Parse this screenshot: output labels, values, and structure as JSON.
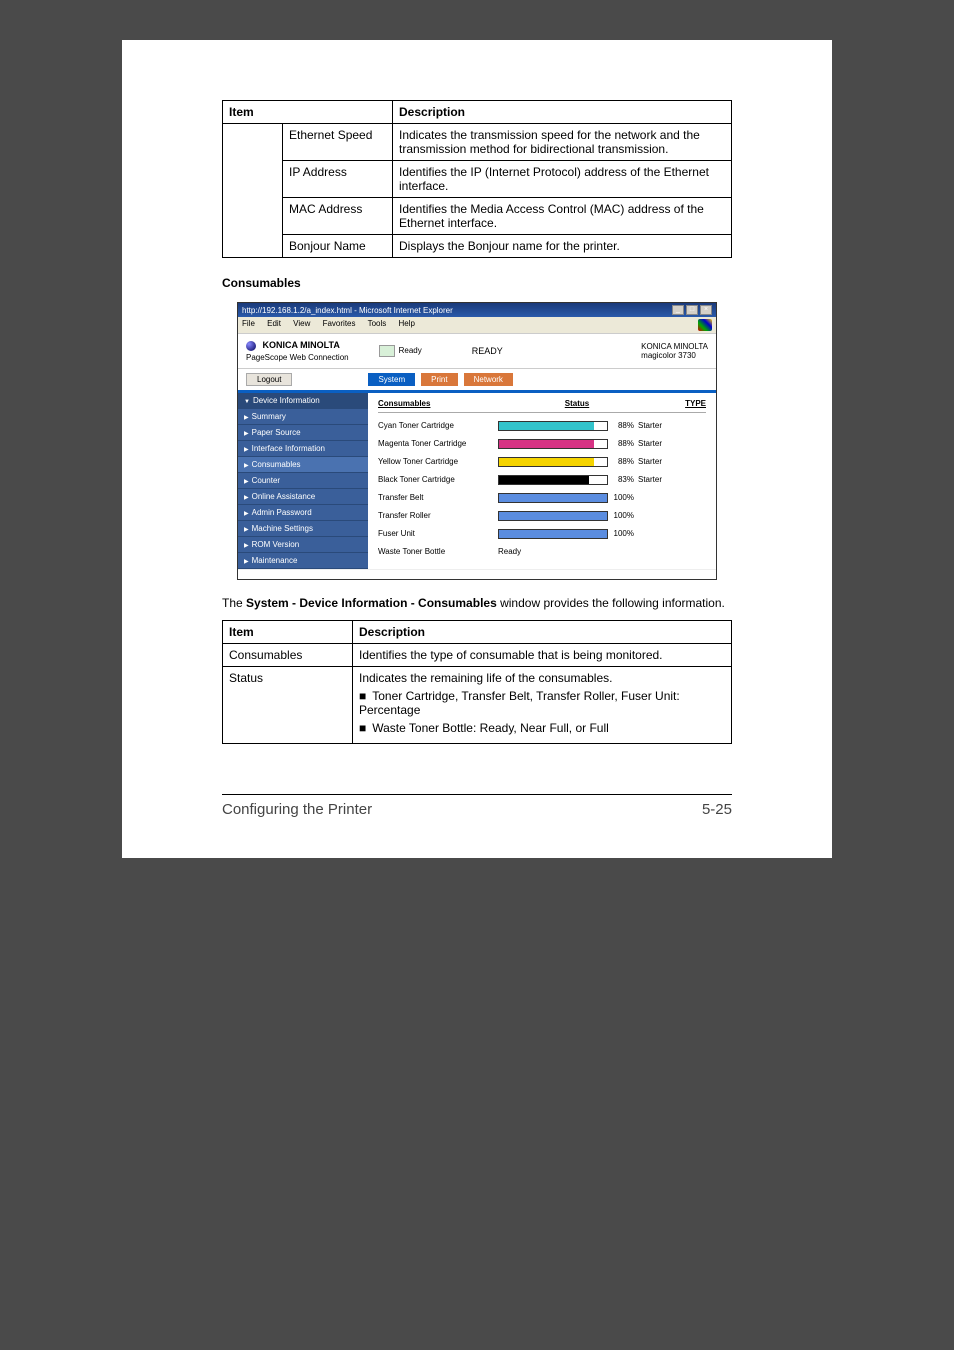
{
  "table1": {
    "headers": {
      "item": "Item",
      "desc": "Description"
    },
    "rows": [
      {
        "item": "Ethernet Speed",
        "desc": "Indicates the transmission speed for the network and the transmission method for bidirectional transmission."
      },
      {
        "item": "IP Address",
        "desc": "Identifies the IP (Internet Protocol) address of the Ethernet interface."
      },
      {
        "item": "MAC Address",
        "desc": "Identifies the Media Access Control (MAC) address of the Ethernet interface."
      },
      {
        "item": "Bonjour Name",
        "desc": "Displays the Bonjour name for the printer."
      }
    ]
  },
  "sectionHeading": "Consumables",
  "screenshot": {
    "titlebar": "http://192.168.1.2/a_index.html - Microsoft Internet Explorer",
    "winControls": {
      "min": "_",
      "max": "□",
      "close": "×"
    },
    "menubar": [
      "File",
      "Edit",
      "View",
      "Favorites",
      "Tools",
      "Help"
    ],
    "brand": "KONICA MINOLTA",
    "webconn": "PageScope Web Connection",
    "statusText": "Ready",
    "centerStatus": "READY",
    "rightBrand1": "KONICA MINOLTA",
    "rightBrand2": "magicolor 3730",
    "logout": "Logout",
    "tabs": {
      "system": "System",
      "print": "Print",
      "network": "Network"
    },
    "sidebar": [
      {
        "label": "Device Information",
        "type": "header"
      },
      {
        "label": "Summary",
        "type": "sub"
      },
      {
        "label": "Paper Source",
        "type": "sub"
      },
      {
        "label": "Interface Information",
        "type": "sub"
      },
      {
        "label": "Consumables",
        "type": "sub sel"
      },
      {
        "label": "Counter",
        "type": "item"
      },
      {
        "label": "Online Assistance",
        "type": "item"
      },
      {
        "label": "Admin Password",
        "type": "item"
      },
      {
        "label": "Machine Settings",
        "type": "item"
      },
      {
        "label": "ROM Version",
        "type": "item"
      },
      {
        "label": "Maintenance",
        "type": "item"
      }
    ],
    "contentHeader": {
      "col1": "Consumables",
      "col2": "Status",
      "col3": "TYPE"
    },
    "rows": [
      {
        "name": "Cyan Toner Cartridge",
        "pct": 88,
        "fill": "bar-fill-cyan",
        "type": "Starter"
      },
      {
        "name": "Magenta Toner Cartridge",
        "pct": 88,
        "fill": "bar-fill-magenta",
        "type": "Starter"
      },
      {
        "name": "Yellow Toner Cartridge",
        "pct": 88,
        "fill": "bar-fill-yellow",
        "type": "Starter"
      },
      {
        "name": "Black Toner Cartridge",
        "pct": 83,
        "fill": "bar-fill-black",
        "type": "Starter"
      },
      {
        "name": "Transfer Belt",
        "pct": 100,
        "fill": "bar-fill-blue",
        "type": ""
      },
      {
        "name": "Transfer Roller",
        "pct": 100,
        "fill": "bar-fill-blue",
        "type": ""
      },
      {
        "name": "Fuser Unit",
        "pct": 100,
        "fill": "bar-fill-blue",
        "type": ""
      }
    ],
    "wasteRow": {
      "name": "Waste Toner Bottle",
      "status": "Ready"
    }
  },
  "para": {
    "pre": "The ",
    "bold": "System - Device Information - Consumables",
    "post": " window provides the following information."
  },
  "table2": {
    "headers": {
      "item": "Item",
      "desc": "Description"
    },
    "rows": [
      {
        "item": "Consumables",
        "desc": "Identifies the type of consumable that is being monitored."
      },
      {
        "item": "Status",
        "desc": "Indicates the remaining life of the consumables.",
        "bullets": [
          "Toner Cartridge, Transfer Belt, Transfer Roller, Fuser Unit: Percentage",
          "Waste Toner Bottle: Ready, Near Full, or Full"
        ]
      }
    ]
  },
  "footer": {
    "left": "Configuring the Printer",
    "right": "5-25"
  }
}
